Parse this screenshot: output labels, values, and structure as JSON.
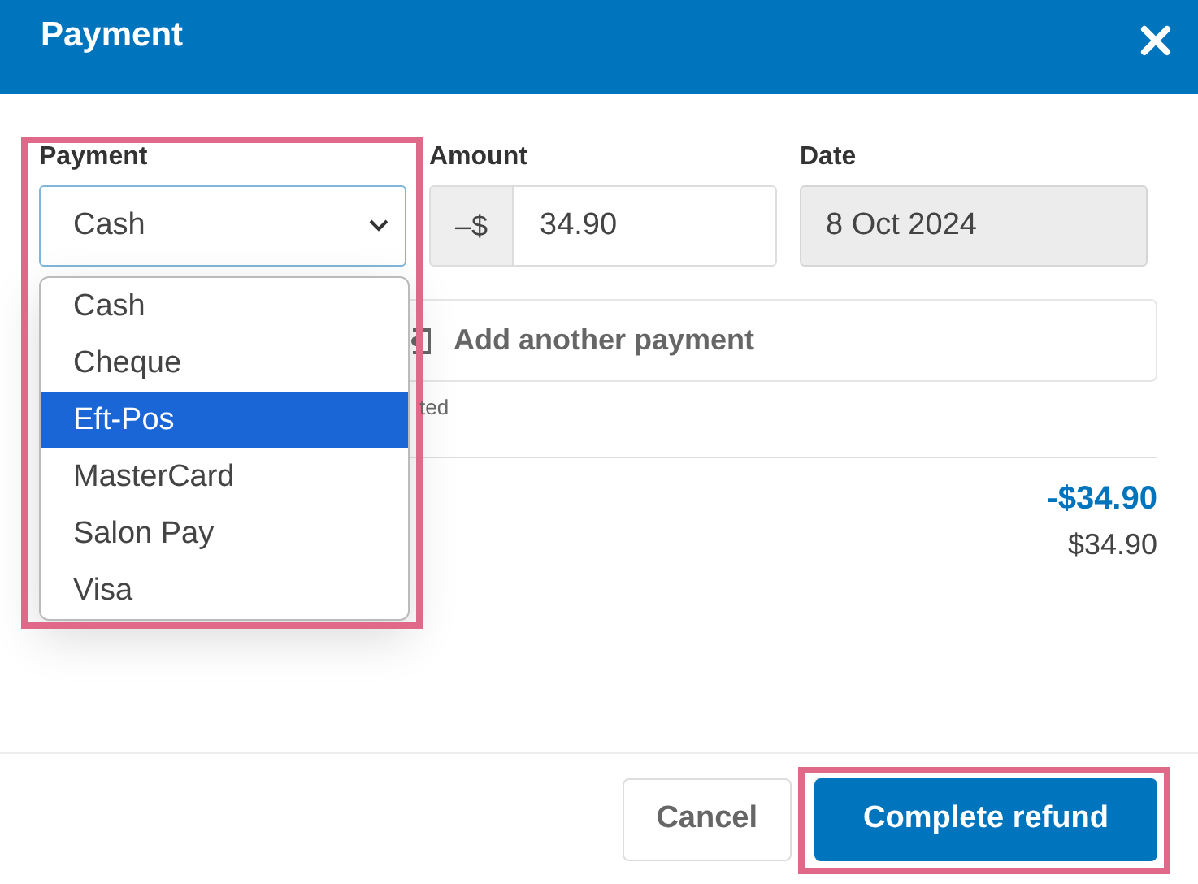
{
  "dialog": {
    "title": "Payment"
  },
  "payment": {
    "label": "Payment",
    "value": "Cash",
    "options": [
      {
        "label": "Cash",
        "highlighted": false
      },
      {
        "label": "Cheque",
        "highlighted": false
      },
      {
        "label": "Eft-Pos",
        "highlighted": true
      },
      {
        "label": "MasterCard",
        "highlighted": false
      },
      {
        "label": "Salon Pay",
        "highlighted": false
      },
      {
        "label": "Visa",
        "highlighted": false
      }
    ]
  },
  "amount": {
    "label": "Amount",
    "prefix": "–$",
    "value": "34.90"
  },
  "date": {
    "label": "Date",
    "value": "8 Oct 2024",
    "disabled": true
  },
  "add_payment": {
    "label": "Add another payment"
  },
  "note": "ted",
  "totals": [
    {
      "text": "-$34.90",
      "kind": "total"
    },
    {
      "text": "$34.90",
      "kind": "amount"
    }
  ],
  "buttons": [
    {
      "label": "Cancel",
      "kind": "secondary"
    },
    {
      "label": "Complete refund",
      "kind": "primary"
    }
  ]
}
